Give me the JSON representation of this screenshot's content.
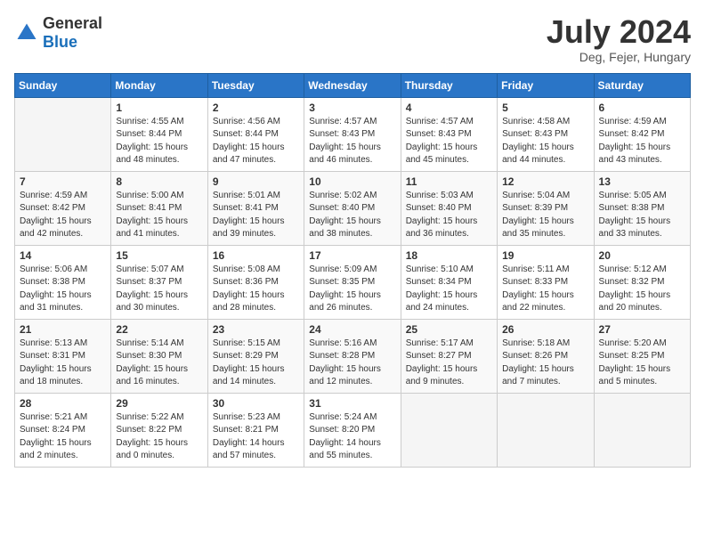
{
  "logo": {
    "general": "General",
    "blue": "Blue"
  },
  "header": {
    "month_year": "July 2024",
    "location": "Deg, Fejer, Hungary"
  },
  "days_of_week": [
    "Sunday",
    "Monday",
    "Tuesday",
    "Wednesday",
    "Thursday",
    "Friday",
    "Saturday"
  ],
  "weeks": [
    [
      {
        "day": "",
        "sunrise": "",
        "sunset": "",
        "daylight": ""
      },
      {
        "day": "1",
        "sunrise": "Sunrise: 4:55 AM",
        "sunset": "Sunset: 8:44 PM",
        "daylight": "Daylight: 15 hours and 48 minutes."
      },
      {
        "day": "2",
        "sunrise": "Sunrise: 4:56 AM",
        "sunset": "Sunset: 8:44 PM",
        "daylight": "Daylight: 15 hours and 47 minutes."
      },
      {
        "day": "3",
        "sunrise": "Sunrise: 4:57 AM",
        "sunset": "Sunset: 8:43 PM",
        "daylight": "Daylight: 15 hours and 46 minutes."
      },
      {
        "day": "4",
        "sunrise": "Sunrise: 4:57 AM",
        "sunset": "Sunset: 8:43 PM",
        "daylight": "Daylight: 15 hours and 45 minutes."
      },
      {
        "day": "5",
        "sunrise": "Sunrise: 4:58 AM",
        "sunset": "Sunset: 8:43 PM",
        "daylight": "Daylight: 15 hours and 44 minutes."
      },
      {
        "day": "6",
        "sunrise": "Sunrise: 4:59 AM",
        "sunset": "Sunset: 8:42 PM",
        "daylight": "Daylight: 15 hours and 43 minutes."
      }
    ],
    [
      {
        "day": "7",
        "sunrise": "Sunrise: 4:59 AM",
        "sunset": "Sunset: 8:42 PM",
        "daylight": "Daylight: 15 hours and 42 minutes."
      },
      {
        "day": "8",
        "sunrise": "Sunrise: 5:00 AM",
        "sunset": "Sunset: 8:41 PM",
        "daylight": "Daylight: 15 hours and 41 minutes."
      },
      {
        "day": "9",
        "sunrise": "Sunrise: 5:01 AM",
        "sunset": "Sunset: 8:41 PM",
        "daylight": "Daylight: 15 hours and 39 minutes."
      },
      {
        "day": "10",
        "sunrise": "Sunrise: 5:02 AM",
        "sunset": "Sunset: 8:40 PM",
        "daylight": "Daylight: 15 hours and 38 minutes."
      },
      {
        "day": "11",
        "sunrise": "Sunrise: 5:03 AM",
        "sunset": "Sunset: 8:40 PM",
        "daylight": "Daylight: 15 hours and 36 minutes."
      },
      {
        "day": "12",
        "sunrise": "Sunrise: 5:04 AM",
        "sunset": "Sunset: 8:39 PM",
        "daylight": "Daylight: 15 hours and 35 minutes."
      },
      {
        "day": "13",
        "sunrise": "Sunrise: 5:05 AM",
        "sunset": "Sunset: 8:38 PM",
        "daylight": "Daylight: 15 hours and 33 minutes."
      }
    ],
    [
      {
        "day": "14",
        "sunrise": "Sunrise: 5:06 AM",
        "sunset": "Sunset: 8:38 PM",
        "daylight": "Daylight: 15 hours and 31 minutes."
      },
      {
        "day": "15",
        "sunrise": "Sunrise: 5:07 AM",
        "sunset": "Sunset: 8:37 PM",
        "daylight": "Daylight: 15 hours and 30 minutes."
      },
      {
        "day": "16",
        "sunrise": "Sunrise: 5:08 AM",
        "sunset": "Sunset: 8:36 PM",
        "daylight": "Daylight: 15 hours and 28 minutes."
      },
      {
        "day": "17",
        "sunrise": "Sunrise: 5:09 AM",
        "sunset": "Sunset: 8:35 PM",
        "daylight": "Daylight: 15 hours and 26 minutes."
      },
      {
        "day": "18",
        "sunrise": "Sunrise: 5:10 AM",
        "sunset": "Sunset: 8:34 PM",
        "daylight": "Daylight: 15 hours and 24 minutes."
      },
      {
        "day": "19",
        "sunrise": "Sunrise: 5:11 AM",
        "sunset": "Sunset: 8:33 PM",
        "daylight": "Daylight: 15 hours and 22 minutes."
      },
      {
        "day": "20",
        "sunrise": "Sunrise: 5:12 AM",
        "sunset": "Sunset: 8:32 PM",
        "daylight": "Daylight: 15 hours and 20 minutes."
      }
    ],
    [
      {
        "day": "21",
        "sunrise": "Sunrise: 5:13 AM",
        "sunset": "Sunset: 8:31 PM",
        "daylight": "Daylight: 15 hours and 18 minutes."
      },
      {
        "day": "22",
        "sunrise": "Sunrise: 5:14 AM",
        "sunset": "Sunset: 8:30 PM",
        "daylight": "Daylight: 15 hours and 16 minutes."
      },
      {
        "day": "23",
        "sunrise": "Sunrise: 5:15 AM",
        "sunset": "Sunset: 8:29 PM",
        "daylight": "Daylight: 15 hours and 14 minutes."
      },
      {
        "day": "24",
        "sunrise": "Sunrise: 5:16 AM",
        "sunset": "Sunset: 8:28 PM",
        "daylight": "Daylight: 15 hours and 12 minutes."
      },
      {
        "day": "25",
        "sunrise": "Sunrise: 5:17 AM",
        "sunset": "Sunset: 8:27 PM",
        "daylight": "Daylight: 15 hours and 9 minutes."
      },
      {
        "day": "26",
        "sunrise": "Sunrise: 5:18 AM",
        "sunset": "Sunset: 8:26 PM",
        "daylight": "Daylight: 15 hours and 7 minutes."
      },
      {
        "day": "27",
        "sunrise": "Sunrise: 5:20 AM",
        "sunset": "Sunset: 8:25 PM",
        "daylight": "Daylight: 15 hours and 5 minutes."
      }
    ],
    [
      {
        "day": "28",
        "sunrise": "Sunrise: 5:21 AM",
        "sunset": "Sunset: 8:24 PM",
        "daylight": "Daylight: 15 hours and 2 minutes."
      },
      {
        "day": "29",
        "sunrise": "Sunrise: 5:22 AM",
        "sunset": "Sunset: 8:22 PM",
        "daylight": "Daylight: 15 hours and 0 minutes."
      },
      {
        "day": "30",
        "sunrise": "Sunrise: 5:23 AM",
        "sunset": "Sunset: 8:21 PM",
        "daylight": "Daylight: 14 hours and 57 minutes."
      },
      {
        "day": "31",
        "sunrise": "Sunrise: 5:24 AM",
        "sunset": "Sunset: 8:20 PM",
        "daylight": "Daylight: 14 hours and 55 minutes."
      },
      {
        "day": "",
        "sunrise": "",
        "sunset": "",
        "daylight": ""
      },
      {
        "day": "",
        "sunrise": "",
        "sunset": "",
        "daylight": ""
      },
      {
        "day": "",
        "sunrise": "",
        "sunset": "",
        "daylight": ""
      }
    ]
  ]
}
